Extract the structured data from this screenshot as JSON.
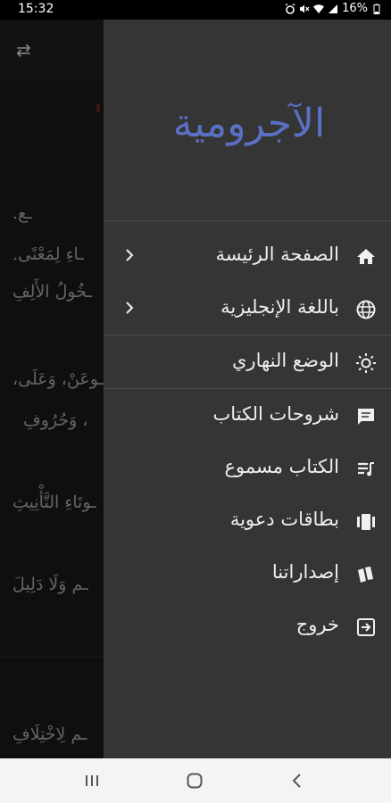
{
  "status_bar": {
    "time": "15:32",
    "battery_percent": "16%",
    "icons": [
      "alarm-icon",
      "mute-icon",
      "wifi-icon",
      "signal-icon",
      "battery-icon"
    ]
  },
  "background": {
    "lines": [
      "ـع.",
      "ـاءِ لِمَعْنًى.",
      "ـخُولُ الأَلِفِ",
      "ـوعَنْ، وَعَلَى،",
      "، وَحُرُوفِ",
      "ـوتَاءِ التَّأْنِيثِ",
      "ـم وَلَا دَلِيلَ",
      "ـم لِاخْتِلَافِ"
    ]
  },
  "drawer": {
    "logo_text": "الآجرومية",
    "items": [
      {
        "label": "الصفحة الرئيسة",
        "icon": "home-icon",
        "has_chevron": true
      },
      {
        "label": "باللغة الإنجليزية",
        "icon": "globe-icon",
        "has_chevron": true
      },
      {
        "label": "الوضع النهاري",
        "icon": "sun-icon",
        "has_chevron": false
      },
      {
        "label": "شروحات الكتاب",
        "icon": "comment-icon",
        "has_chevron": false
      },
      {
        "label": "الكتاب مسموع",
        "icon": "playlist-icon",
        "has_chevron": false
      },
      {
        "label": "بطاقات دعوية",
        "icon": "cards-icon",
        "has_chevron": false
      },
      {
        "label": "إصداراتنا",
        "icon": "books-icon",
        "has_chevron": false
      },
      {
        "label": "خروج",
        "icon": "exit-icon",
        "has_chevron": false
      }
    ]
  },
  "nav_bar": {
    "buttons": [
      "recents-icon",
      "home-circle-icon",
      "back-icon"
    ]
  },
  "colors": {
    "drawer_bg": "#353535",
    "logo": "#5b6fc4",
    "background": "#171717",
    "navbar": "#f4f4f4"
  }
}
